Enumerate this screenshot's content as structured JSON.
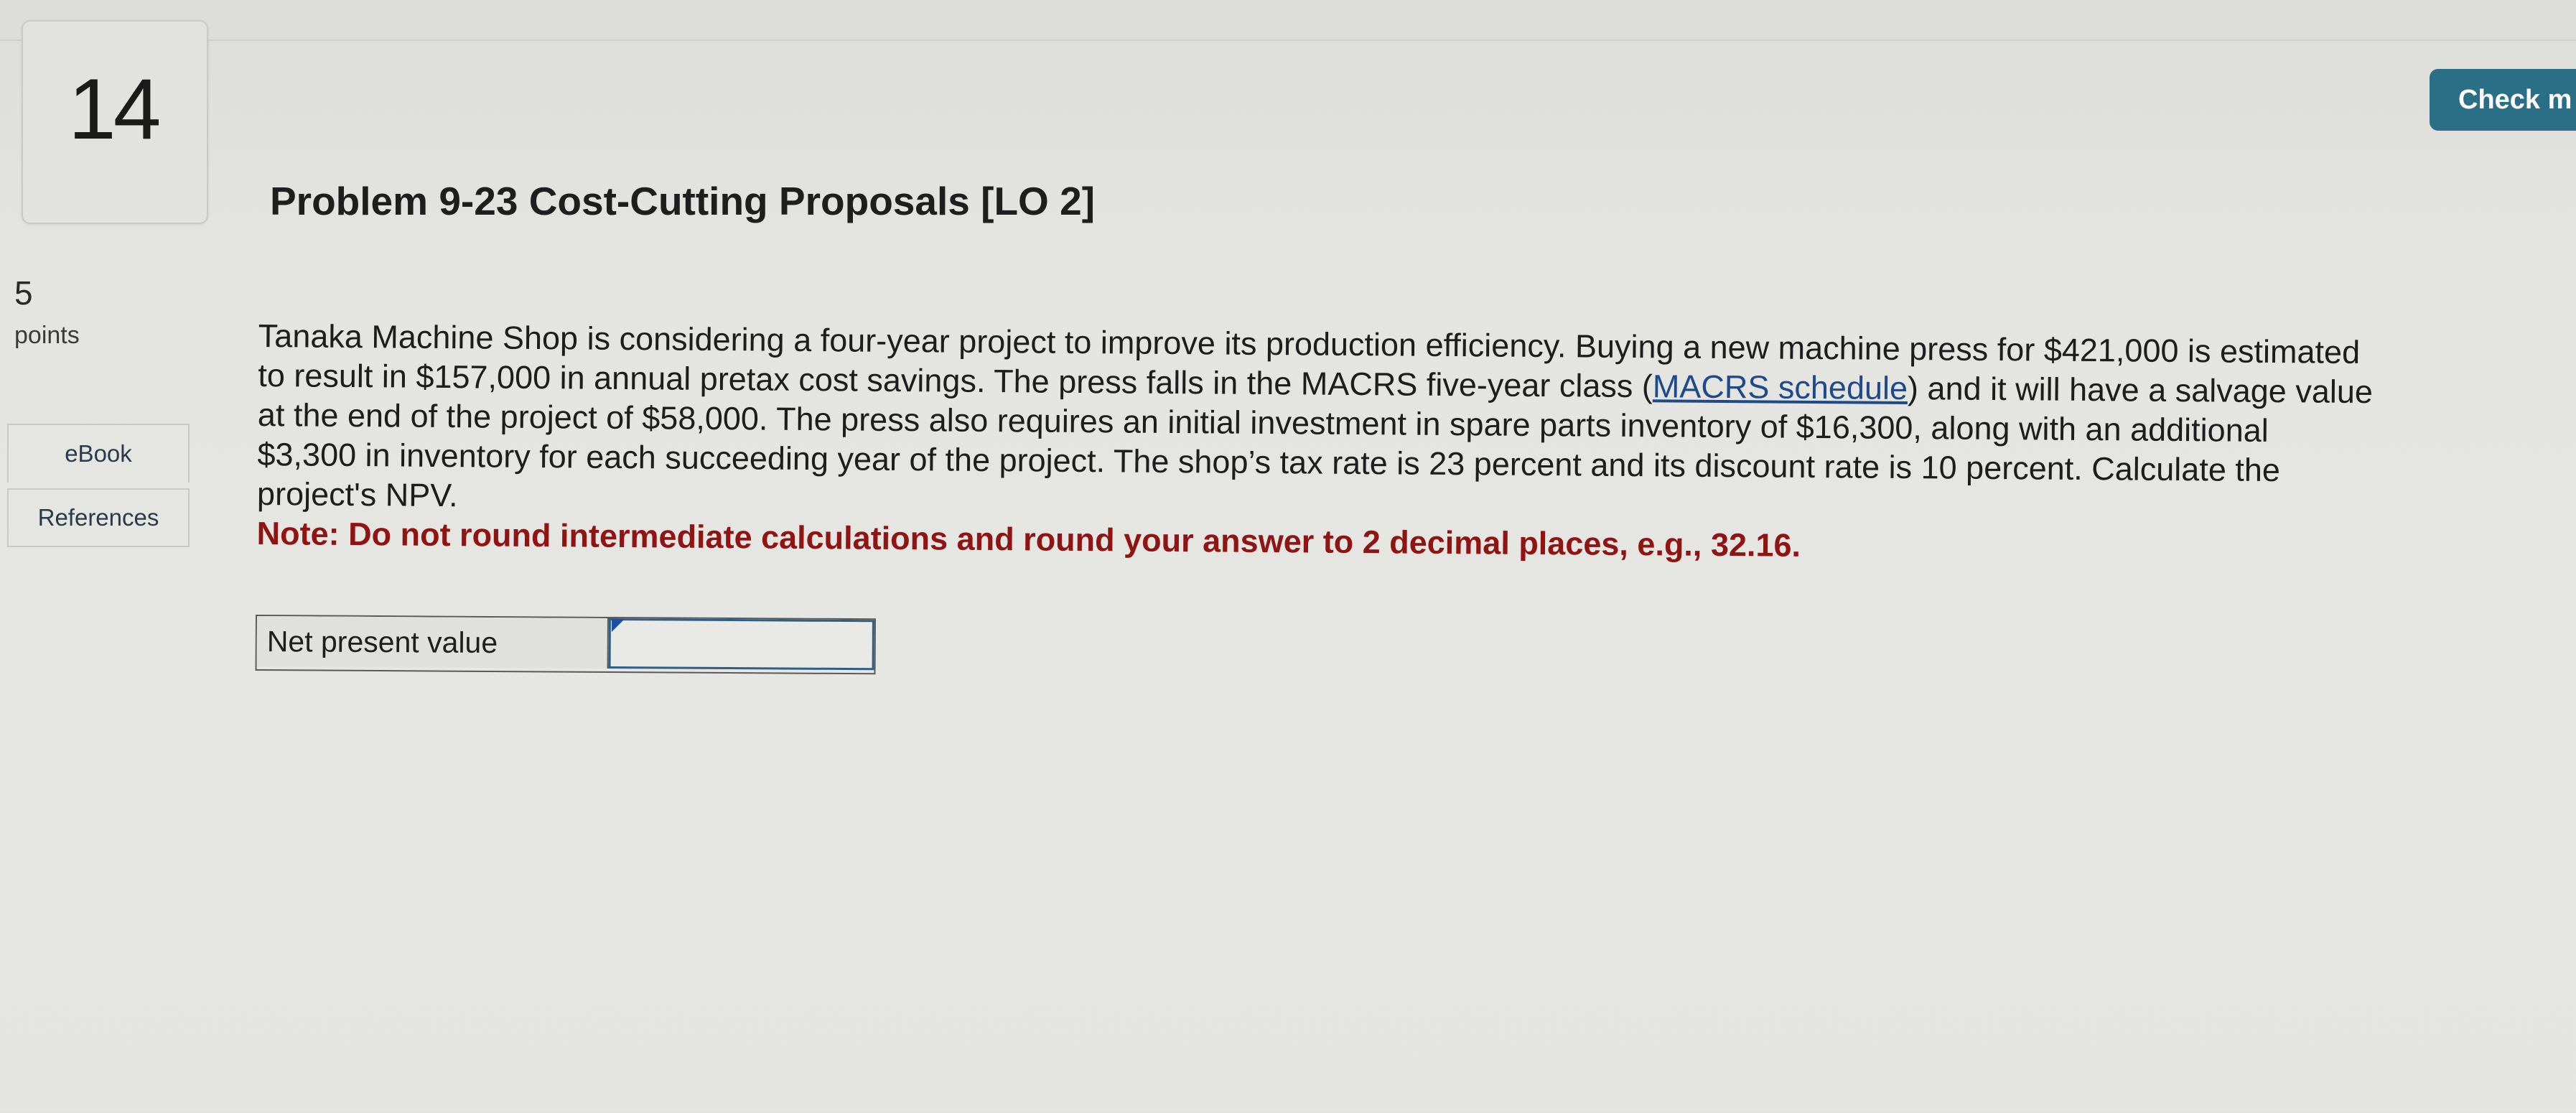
{
  "question": {
    "number": "14",
    "points_value": "5",
    "points_label": "points"
  },
  "sidebar": {
    "ebook_label": "eBook",
    "references_label": "References"
  },
  "header": {
    "check_button_label": "Check m"
  },
  "problem": {
    "title": "Problem 9-23 Cost-Cutting Proposals [LO 2]",
    "text_before_link": "Tanaka Machine Shop is considering a four-year project to improve its production efficiency. Buying a new machine press for $421,000 is estimated to result in $157,000 in annual pretax cost savings. The press falls in the MACRS five-year class (",
    "link_text": "MACRS schedule",
    "text_after_link": ") and it will have a salvage value at the end of the project of $58,000. The press also requires an initial investment in spare parts inventory of $16,300, along with an additional $3,300 in inventory for each succeeding year of the project. The shop’s tax rate is 23 percent and its discount rate is 10 percent. Calculate the project's NPV.",
    "note": "Note: Do not round intermediate calculations and round your answer to 2 decimal places, e.g., 32.16."
  },
  "answer": {
    "label": "Net present value",
    "value": ""
  }
}
